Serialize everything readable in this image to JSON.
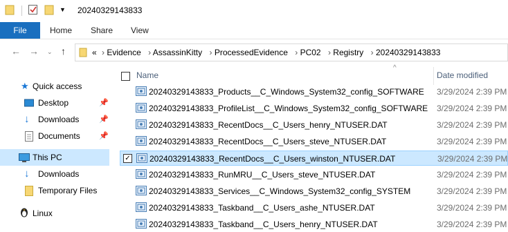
{
  "window": {
    "title": "20240329143833"
  },
  "ribbon": {
    "tabs": [
      "File",
      "Home",
      "Share",
      "View"
    ]
  },
  "address": {
    "overflow": "«",
    "crumbs": [
      "Evidence",
      "AssassinKitty",
      "ProcessedEvidence",
      "PC02",
      "Registry",
      "20240329143833"
    ]
  },
  "sidebar": {
    "items": [
      {
        "label": "Quick access",
        "icon": "star-icon"
      },
      {
        "label": "Desktop",
        "icon": "desktop-icon",
        "pinned": true
      },
      {
        "label": "Downloads",
        "icon": "download-arrow-icon",
        "pinned": true
      },
      {
        "label": "Documents",
        "icon": "documents-icon",
        "pinned": true
      },
      {
        "label": "This PC",
        "icon": "computer-icon",
        "selected": true
      },
      {
        "label": "Downloads",
        "icon": "download-arrow-icon"
      },
      {
        "label": "Temporary Files",
        "icon": "folder-icon"
      },
      {
        "label": "Linux",
        "icon": "penguin-icon"
      }
    ]
  },
  "columns": {
    "name": "Name",
    "date_modified": "Date modified"
  },
  "files": [
    {
      "name": "20240329143833_Products__C_Windows_System32_config_SOFTWARE",
      "date": "3/29/2024 2:39 PM"
    },
    {
      "name": "20240329143833_ProfileList__C_Windows_System32_config_SOFTWARE",
      "date": "3/29/2024 2:39 PM"
    },
    {
      "name": "20240329143833_RecentDocs__C_Users_henry_NTUSER.DAT",
      "date": "3/29/2024 2:39 PM"
    },
    {
      "name": "20240329143833_RecentDocs__C_Users_steve_NTUSER.DAT",
      "date": "3/29/2024 2:39 PM"
    },
    {
      "name": "20240329143833_RecentDocs__C_Users_winston_NTUSER.DAT",
      "date": "3/29/2024 2:39 PM",
      "selected": true
    },
    {
      "name": "20240329143833_RunMRU__C_Users_steve_NTUSER.DAT",
      "date": "3/29/2024 2:39 PM"
    },
    {
      "name": "20240329143833_Services__C_Windows_System32_config_SYSTEM",
      "date": "3/29/2024 2:39 PM"
    },
    {
      "name": "20240329143833_Taskband__C_Users_ashe_NTUSER.DAT",
      "date": "3/29/2024 2:39 PM"
    },
    {
      "name": "20240329143833_Taskband__C_Users_henry_NTUSER.DAT",
      "date": "3/29/2024 2:39 PM"
    }
  ],
  "colors": {
    "accent": "#1a6fbf",
    "selection": "#cce8ff",
    "folder": "#f7d774"
  }
}
